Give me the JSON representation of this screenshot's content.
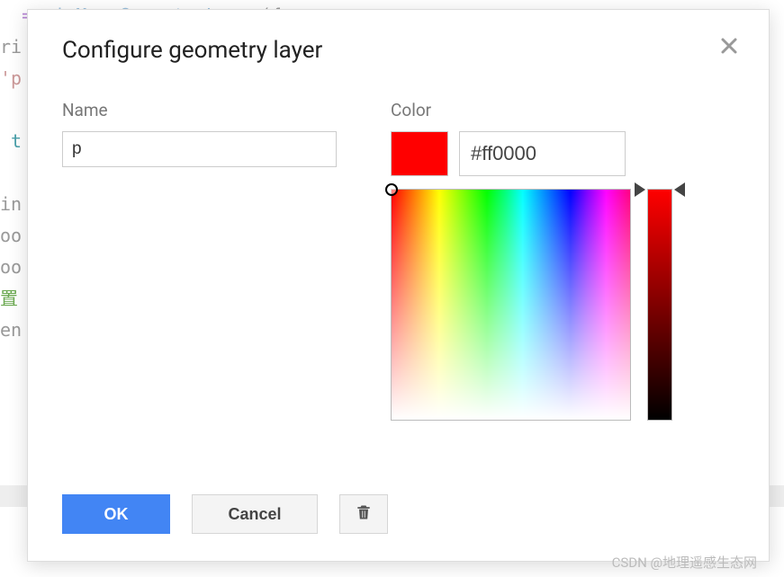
{
  "background": {
    "code_lines": [
      "  = ui.Map.GeometryLayer({",
      "ri",
      "'p",
      "",
      " t",
      "",
      "in",
      "oo",
      "oo",
      "置",
      "en"
    ]
  },
  "dialog": {
    "title": "Configure geometry layer",
    "name_label": "Name",
    "name_value": "p",
    "color_label": "Color",
    "color_hex": "#ff0000",
    "swatch_color": "#ff0000"
  },
  "buttons": {
    "ok_label": "OK",
    "cancel_label": "Cancel"
  },
  "watermark": "CSDN @地理遥感生态网"
}
